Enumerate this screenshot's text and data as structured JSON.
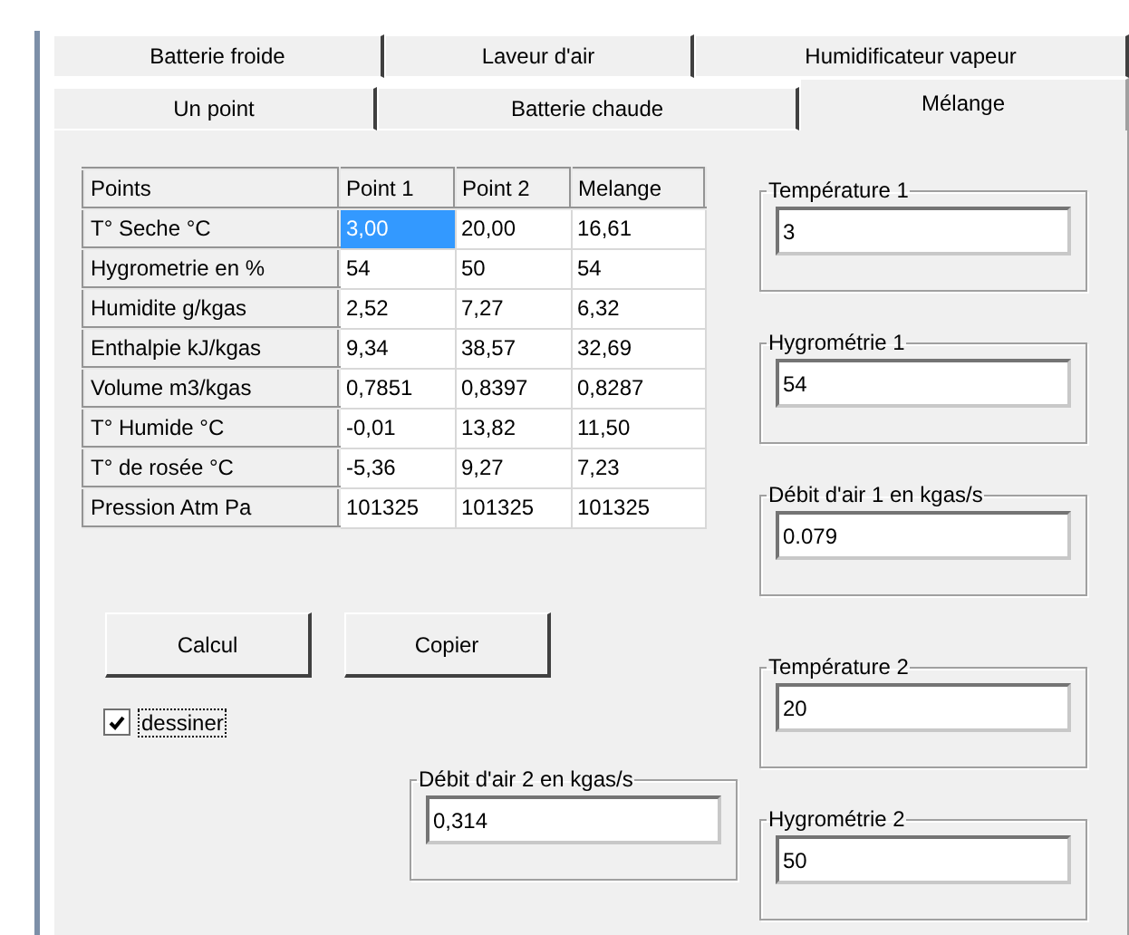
{
  "tab_rows": [
    {
      "tabs": [
        {
          "label": "Batterie froide",
          "selected": false
        },
        {
          "label": "Laveur d'air",
          "selected": false
        },
        {
          "label": "Humidificateur vapeur",
          "selected": false
        }
      ]
    },
    {
      "tabs": [
        {
          "label": "Un point",
          "selected": false
        },
        {
          "label": "Batterie chaude",
          "selected": false
        },
        {
          "label": "Mélange",
          "selected": true
        }
      ]
    }
  ],
  "table": {
    "columns": [
      "Points",
      "Point 1",
      "Point 2",
      "Melange"
    ],
    "rows": [
      [
        {
          "text": "T° Seche °C",
          "selected": false
        },
        {
          "text": "3,00",
          "selected": true
        },
        {
          "text": "20,00",
          "selected": false
        },
        {
          "text": "16,61",
          "selected": false
        }
      ],
      [
        {
          "text": "Hygrometrie en %",
          "selected": false
        },
        {
          "text": "54",
          "selected": false
        },
        {
          "text": "50",
          "selected": false
        },
        {
          "text": "54",
          "selected": false
        }
      ],
      [
        {
          "text": "Humidite g/kgas",
          "selected": false
        },
        {
          "text": "2,52",
          "selected": false
        },
        {
          "text": "7,27",
          "selected": false
        },
        {
          "text": "6,32",
          "selected": false
        }
      ],
      [
        {
          "text": "Enthalpie kJ/kgas",
          "selected": false
        },
        {
          "text": "9,34",
          "selected": false
        },
        {
          "text": "38,57",
          "selected": false
        },
        {
          "text": "32,69",
          "selected": false
        }
      ],
      [
        {
          "text": "Volume m3/kgas",
          "selected": false
        },
        {
          "text": "0,7851",
          "selected": false
        },
        {
          "text": "0,8397",
          "selected": false
        },
        {
          "text": "0,8287",
          "selected": false
        }
      ],
      [
        {
          "text": "T° Humide °C",
          "selected": false
        },
        {
          "text": "-0,01",
          "selected": false
        },
        {
          "text": "13,82",
          "selected": false
        },
        {
          "text": "11,50",
          "selected": false
        }
      ],
      [
        {
          "text": "T° de rosée °C",
          "selected": false
        },
        {
          "text": "-5,36",
          "selected": false
        },
        {
          "text": "9,27",
          "selected": false
        },
        {
          "text": "7,23",
          "selected": false
        }
      ],
      [
        {
          "text": "Pression Atm Pa",
          "selected": false
        },
        {
          "text": "101325",
          "selected": false
        },
        {
          "text": "101325",
          "selected": false
        },
        {
          "text": "101325",
          "selected": false
        }
      ]
    ]
  },
  "buttons": [
    "Calcul",
    "Copier"
  ],
  "checkbox": {
    "label": "dessiner",
    "checked": true
  },
  "right_groups": [
    {
      "title": "Température 1",
      "value": "3"
    },
    {
      "title": "Hygrométrie 1",
      "value": "54"
    },
    {
      "title": "Débit d'air 1 en kgas/s",
      "value": "0.079"
    },
    {
      "title": "Température 2",
      "value": "20"
    },
    {
      "title": "Hygrométrie 2",
      "value": "50"
    }
  ],
  "bottom_group": {
    "title": "Débit d'air 2 en kgas/s",
    "value": "0,314"
  }
}
